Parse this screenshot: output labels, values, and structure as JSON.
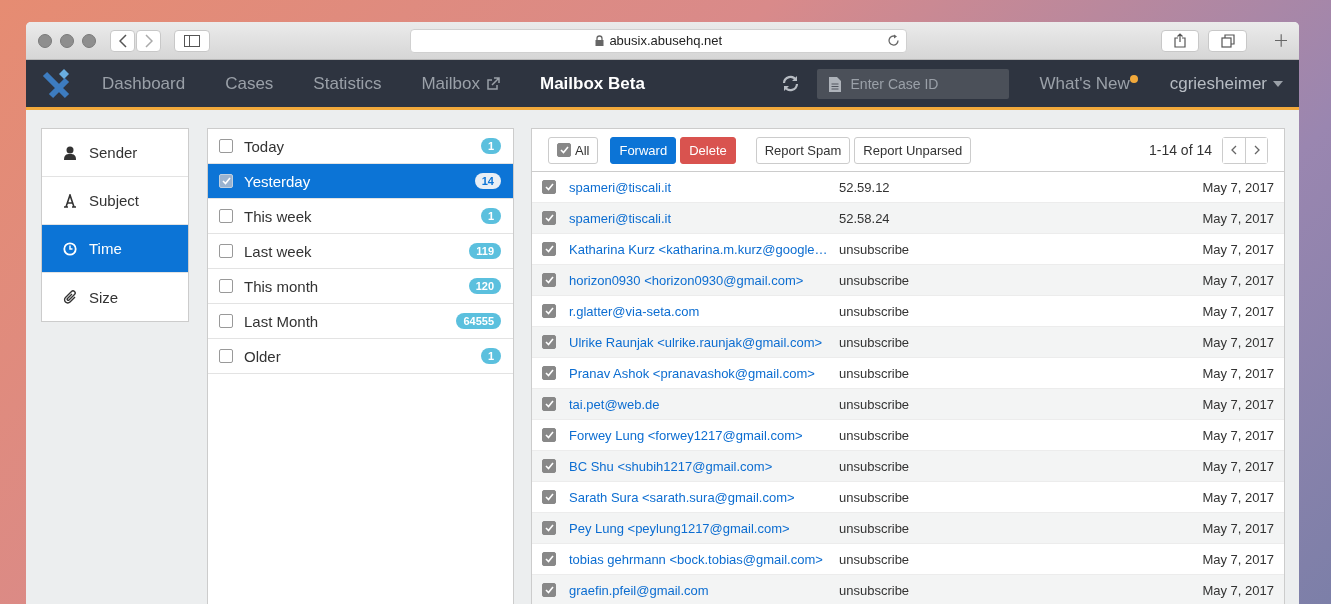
{
  "browser": {
    "url": "abusix.abusehq.net"
  },
  "nav": {
    "items": [
      {
        "label": "Dashboard",
        "selected": false,
        "external": false
      },
      {
        "label": "Cases",
        "selected": false,
        "external": false
      },
      {
        "label": "Statistics",
        "selected": false,
        "external": false
      },
      {
        "label": "Mailbox",
        "selected": false,
        "external": true
      },
      {
        "label": "Mailbox Beta",
        "selected": true,
        "external": false
      }
    ],
    "search": {
      "placeholder": "Enter Case ID"
    },
    "whats_new": "What's New",
    "user": "cgriesheimer"
  },
  "filters": [
    {
      "label": "Sender",
      "kind": "sender",
      "selected": false
    },
    {
      "label": "Subject",
      "kind": "subject",
      "selected": false
    },
    {
      "label": "Time",
      "kind": "time",
      "selected": true
    },
    {
      "label": "Size",
      "kind": "size",
      "selected": false
    }
  ],
  "periods": [
    {
      "label": "Today",
      "count": "1",
      "selected": false
    },
    {
      "label": "Yesterday",
      "count": "14",
      "selected": true
    },
    {
      "label": "This week",
      "count": "1",
      "selected": false
    },
    {
      "label": "Last week",
      "count": "119",
      "selected": false
    },
    {
      "label": "This month",
      "count": "120",
      "selected": false
    },
    {
      "label": "Last Month",
      "count": "64555",
      "selected": false
    },
    {
      "label": "Older",
      "count": "1",
      "selected": false
    }
  ],
  "toolbar": {
    "all": {
      "label": "All",
      "checked": true
    },
    "forward": "Forward",
    "delete": "Delete",
    "report_spam": "Report Spam",
    "report_unparsed": "Report Unparsed",
    "pagination": "1-14 of 14"
  },
  "messages": [
    {
      "sender": "spameri@tiscali.it",
      "subject": "52.59.12",
      "date": "May 7, 2017",
      "checked": true
    },
    {
      "sender": "spameri@tiscali.it",
      "subject": "52.58.24",
      "date": "May 7, 2017",
      "checked": true
    },
    {
      "sender": "Katharina Kurz <katharina.m.kurz@google…",
      "subject": "unsubscribe",
      "date": "May 7, 2017",
      "checked": true
    },
    {
      "sender": "horizon0930 <horizon0930@gmail.com>",
      "subject": "unsubscribe",
      "date": "May 7, 2017",
      "checked": true
    },
    {
      "sender": "r.glatter@via-seta.com",
      "subject": "unsubscribe",
      "date": "May 7, 2017",
      "checked": true
    },
    {
      "sender": "Ulrike Raunjak <ulrike.raunjak@gmail.com>",
      "subject": "unsubscribe",
      "date": "May 7, 2017",
      "checked": true
    },
    {
      "sender": "Pranav Ashok <pranavashok@gmail.com>",
      "subject": "unsubscribe",
      "date": "May 7, 2017",
      "checked": true
    },
    {
      "sender": "tai.pet@web.de",
      "subject": "unsubscribe",
      "date": "May 7, 2017",
      "checked": true
    },
    {
      "sender": "Forwey Lung <forwey1217@gmail.com>",
      "subject": "unsubscribe",
      "date": "May 7, 2017",
      "checked": true
    },
    {
      "sender": "BC Shu <shubih1217@gmail.com>",
      "subject": "unsubscribe",
      "date": "May 7, 2017",
      "checked": true
    },
    {
      "sender": "Sarath Sura <sarath.sura@gmail.com>",
      "subject": "unsubscribe",
      "date": "May 7, 2017",
      "checked": true
    },
    {
      "sender": "Pey Lung <peylung1217@gmail.com>",
      "subject": "unsubscribe",
      "date": "May 7, 2017",
      "checked": true
    },
    {
      "sender": "tobias gehrmann <bock.tobias@gmail.com>",
      "subject": "unsubscribe",
      "date": "May 7, 2017",
      "checked": true
    },
    {
      "sender": "graefin.pfeil@gmail.com",
      "subject": "unsubscribe",
      "date": "May 7, 2017",
      "checked": true
    }
  ]
}
